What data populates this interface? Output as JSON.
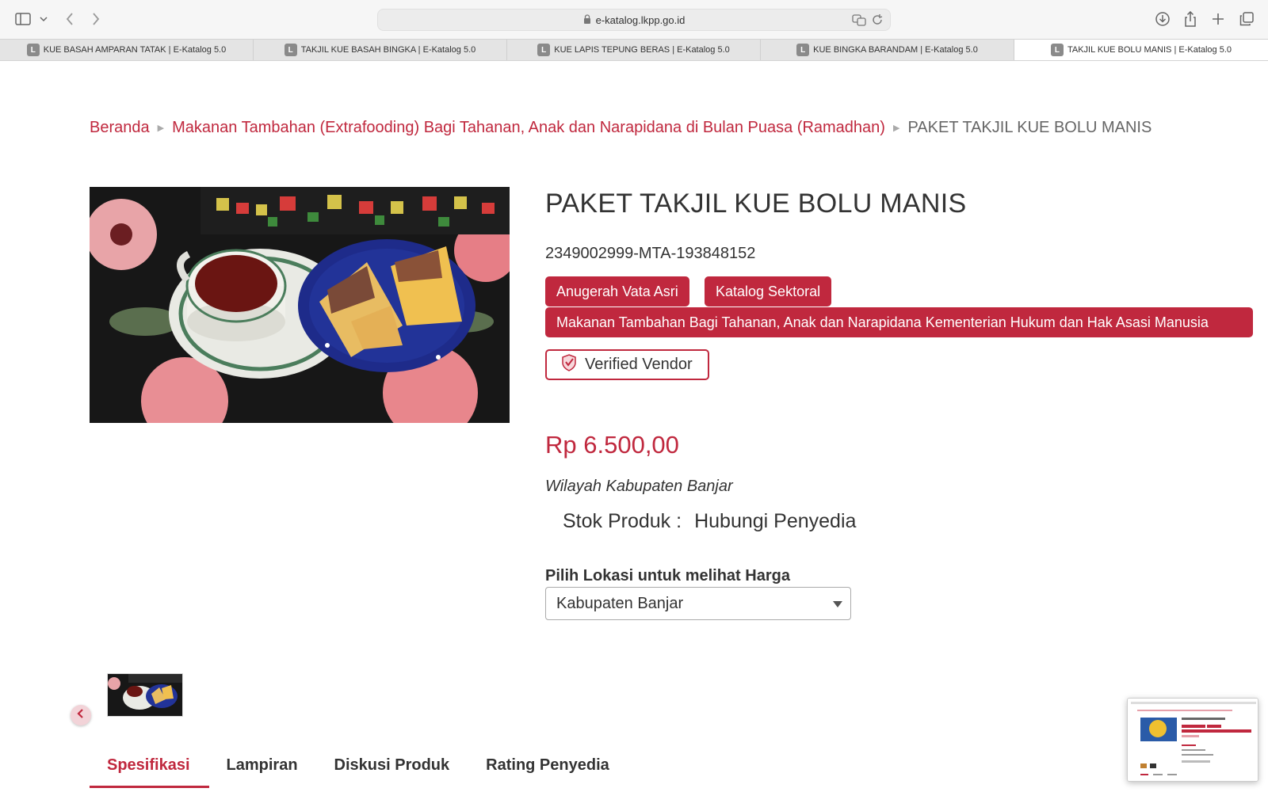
{
  "browser": {
    "url": "e-katalog.lkpp.go.id",
    "tabs": [
      {
        "favicon": "L",
        "title": "KUE BASAH AMPARAN TATAK | E-Katalog 5.0"
      },
      {
        "favicon": "L",
        "title": "TAKJIL KUE BASAH BINGKA | E-Katalog 5.0"
      },
      {
        "favicon": "L",
        "title": "KUE LAPIS TEPUNG BERAS | E-Katalog 5.0"
      },
      {
        "favicon": "L",
        "title": "KUE BINGKA BARANDAM | E-Katalog 5.0"
      },
      {
        "favicon": "L",
        "title": "TAKJIL KUE BOLU MANIS | E-Katalog 5.0"
      }
    ],
    "icons": [
      "sidebar-icon",
      "chevron-down-icon",
      "back-icon",
      "forward-icon",
      "lock-icon",
      "translate-icon",
      "reload-icon",
      "download-icon",
      "share-icon",
      "new-tab-icon",
      "tab-overview-icon"
    ]
  },
  "breadcrumb": {
    "home": "Beranda",
    "category": "Makanan Tambahan (Extrafooding) Bagi Tahanan, Anak dan Narapidana di Bulan Puasa (Ramadhan)",
    "current": "PAKET TAKJIL KUE BOLU MANIS"
  },
  "product": {
    "title": "PAKET TAKJIL KUE BOLU MANIS",
    "sku": "2349002999-MTA-193848152",
    "tags": [
      "Anugerah Vata Asri",
      "Katalog Sektoral",
      "Makanan Tambahan Bagi Tahanan, Anak dan Narapidana Kementerian Hukum dan Hak Asasi Manusia"
    ],
    "verified_label": "Verified Vendor",
    "price": "Rp 6.500,00",
    "region": "Wilayah Kabupaten Banjar",
    "stock_label": "Stok Produk :",
    "stock_value": "Hubungi Penyedia",
    "location_label": "Pilih Lokasi untuk melihat Harga",
    "location_selected": "Kabupaten Banjar"
  },
  "page_tabs": [
    "Spesifikasi",
    "Lampiran",
    "Diskusi Produk",
    "Rating Penyedia"
  ],
  "colors": {
    "accent": "#c0283e",
    "text": "#333333"
  }
}
